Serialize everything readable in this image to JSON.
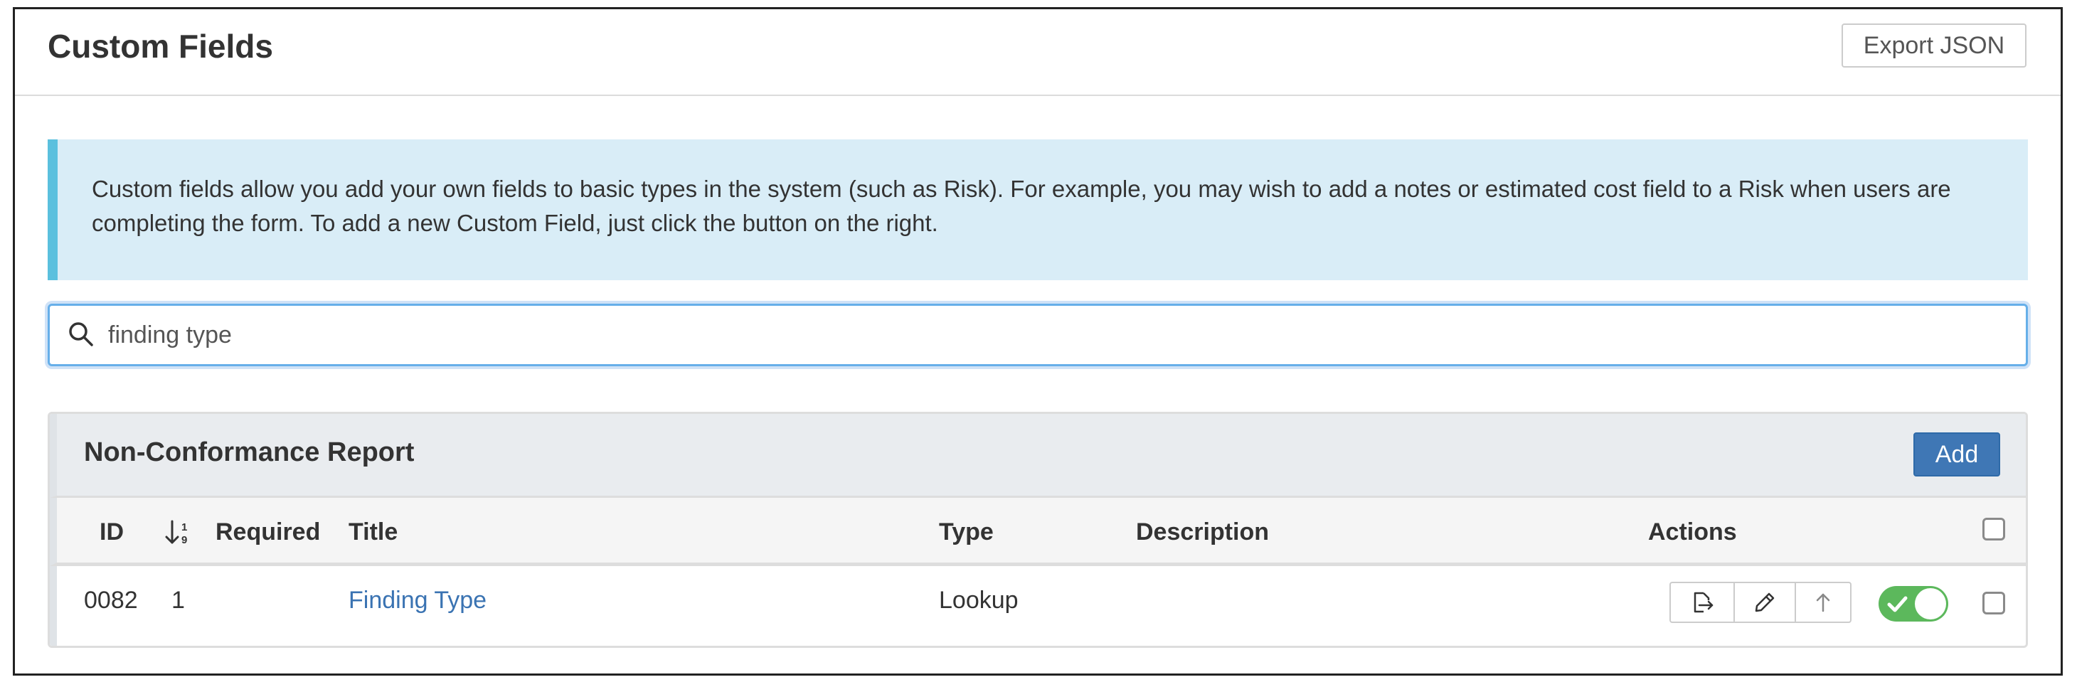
{
  "page": {
    "title": "Custom Fields",
    "export_label": "Export JSON"
  },
  "info": {
    "text": "Custom fields allow you add your own fields to basic types in the system (such as Risk). For example, you may wish to add a notes or estimated cost field to a Risk when users are completing the form. To add a new Custom Field, just click the button on the right."
  },
  "search": {
    "value": "finding type",
    "icon": "search-icon"
  },
  "panel": {
    "title": "Non-Conformance Report",
    "add_label": "Add",
    "columns": {
      "id": "ID",
      "required": "Required",
      "title": "Title",
      "type": "Type",
      "description": "Description",
      "actions": "Actions"
    },
    "sort_icon": "sort-numeric-down-icon",
    "rows": [
      {
        "id": "0082",
        "order": "1",
        "required": "",
        "title": "Finding Type",
        "type": "Lookup",
        "description": "",
        "enabled": true,
        "selected": false,
        "action_icons": [
          "export-icon",
          "pencil-icon",
          "arrow-up-icon"
        ]
      }
    ]
  },
  "colors": {
    "info_bg": "#d9edf7",
    "info_accent": "#5bc0de",
    "primary": "#3f77b5",
    "link": "#3a73b2",
    "toggle_on": "#5cb85c",
    "focus_border": "#66afe9"
  }
}
